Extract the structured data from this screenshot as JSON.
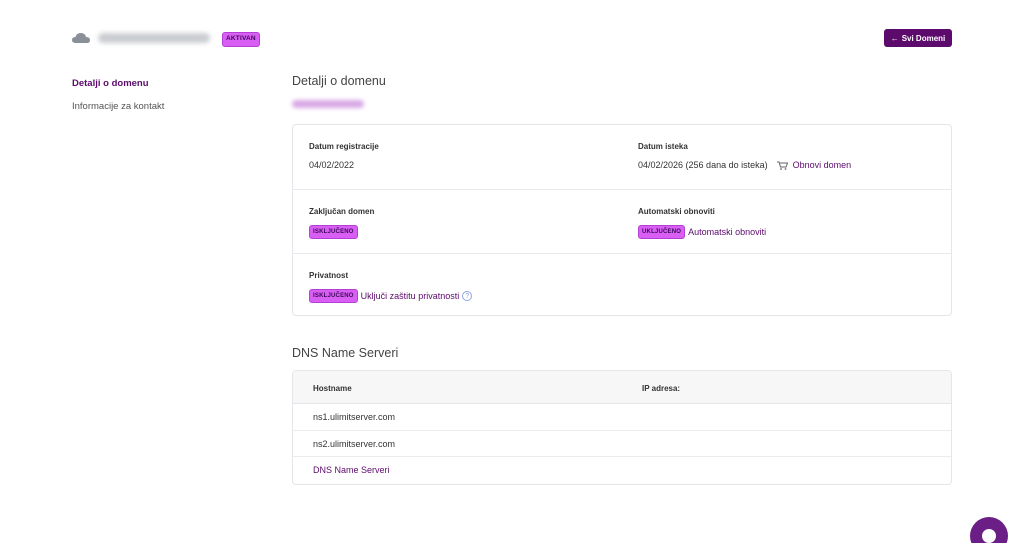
{
  "header": {
    "status_badge": "AKTIVAN",
    "back_button": "Svi Domeni"
  },
  "sidebar": {
    "items": [
      {
        "label": "Detalji o domenu"
      },
      {
        "label": "Informacije za kontakt"
      }
    ]
  },
  "details": {
    "title": "Detalji o domenu",
    "registration_label": "Datum registracije",
    "registration_value": "04/02/2022",
    "expiry_label": "Datum isteka",
    "expiry_value": "04/02/2026 (256 dana do isteka)",
    "renew_link": "Obnovi domen",
    "locked_label": "Zaključan domen",
    "locked_badge": "ISKLJUČENO",
    "auto_renew_label": "Automatski obnoviti",
    "auto_renew_badge": "UKLJUČENO",
    "auto_renew_link": "Automatski obnoviti",
    "privacy_label": "Privatnost",
    "privacy_badge": "ISKLJUČENO",
    "privacy_link": "Uključi zaštitu privatnosti",
    "help_glyph": "?"
  },
  "dns": {
    "title": "DNS Name Serveri",
    "columns": [
      "Hostname",
      "IP adresa:"
    ],
    "rows": [
      "ns1.ulimitserver.com",
      "ns2.ulimitserver.com"
    ],
    "link": "DNS Name Serveri"
  },
  "colors": {
    "accent": "#5c0a6c",
    "badge": "#d95ef4"
  }
}
